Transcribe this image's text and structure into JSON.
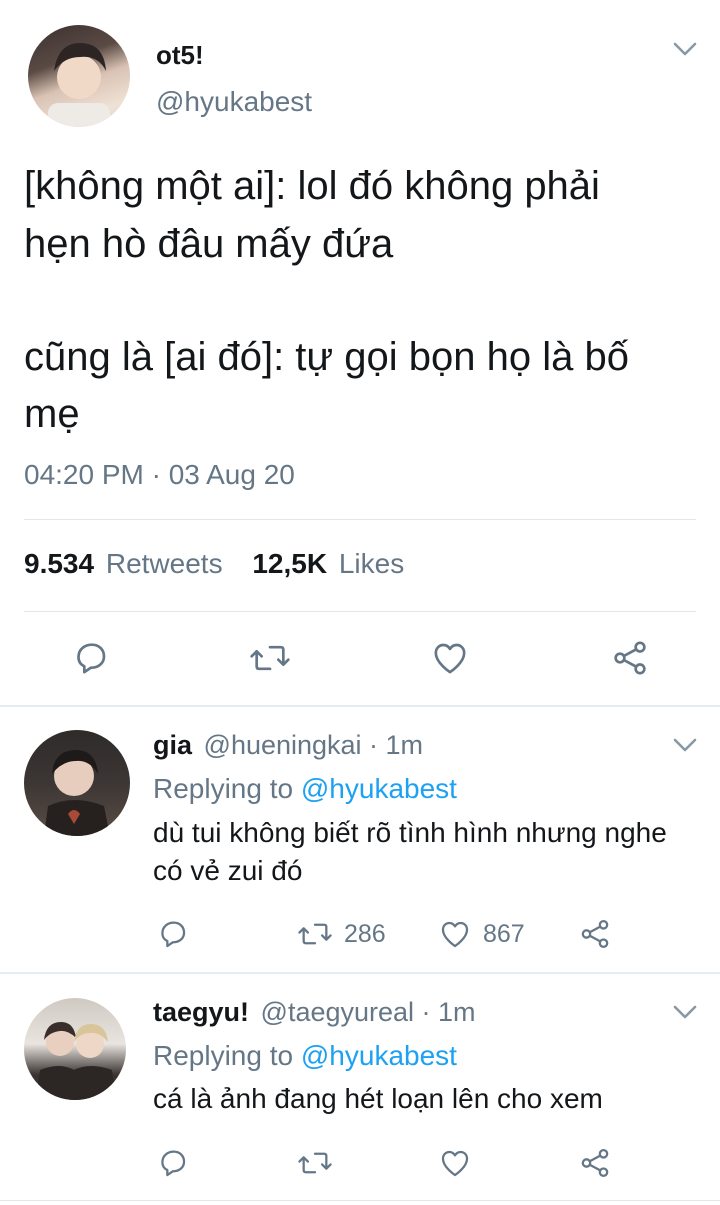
{
  "main_tweet": {
    "display_name": "ot5!",
    "handle": "@hyukabest",
    "text_line1": "[không một ai]: lol đó không phải",
    "text_line2": "hẹn hò đâu mấy đứa",
    "text_line3": "cũng là [ai đó]: tự gọi bọn họ là bố",
    "text_line4": "mẹ",
    "timestamp": "04:20 PM · 03 Aug 20",
    "retweets_count": "9.534",
    "retweets_label": "Retweets",
    "likes_count": "12,5K",
    "likes_label": "Likes"
  },
  "replies": [
    {
      "display_name": "gia",
      "meta": "@hueningkai · 1m",
      "replying_prefix": "Replying to",
      "replying_to": "@hyukabest",
      "text_line1": "dù tui không biết rõ tình hình nhưng nghe",
      "text_line2": "có vẻ zui đó",
      "retweets": "286",
      "likes": "867"
    },
    {
      "display_name": "taegyu!",
      "meta": "@taegyureal · 1m",
      "replying_prefix": "Replying to",
      "replying_to": "@hyukabest",
      "text_line1": "cá là ảnh đang hét loạn lên cho xem",
      "text_line2": "",
      "retweets": "",
      "likes": ""
    }
  ],
  "colors": {
    "text": "#14171a",
    "muted": "#657786",
    "link": "#1da1f2",
    "divider": "#e1e8ed"
  },
  "icons": [
    "chevron-down-icon",
    "reply-icon",
    "retweet-icon",
    "like-icon",
    "share-icon"
  ]
}
